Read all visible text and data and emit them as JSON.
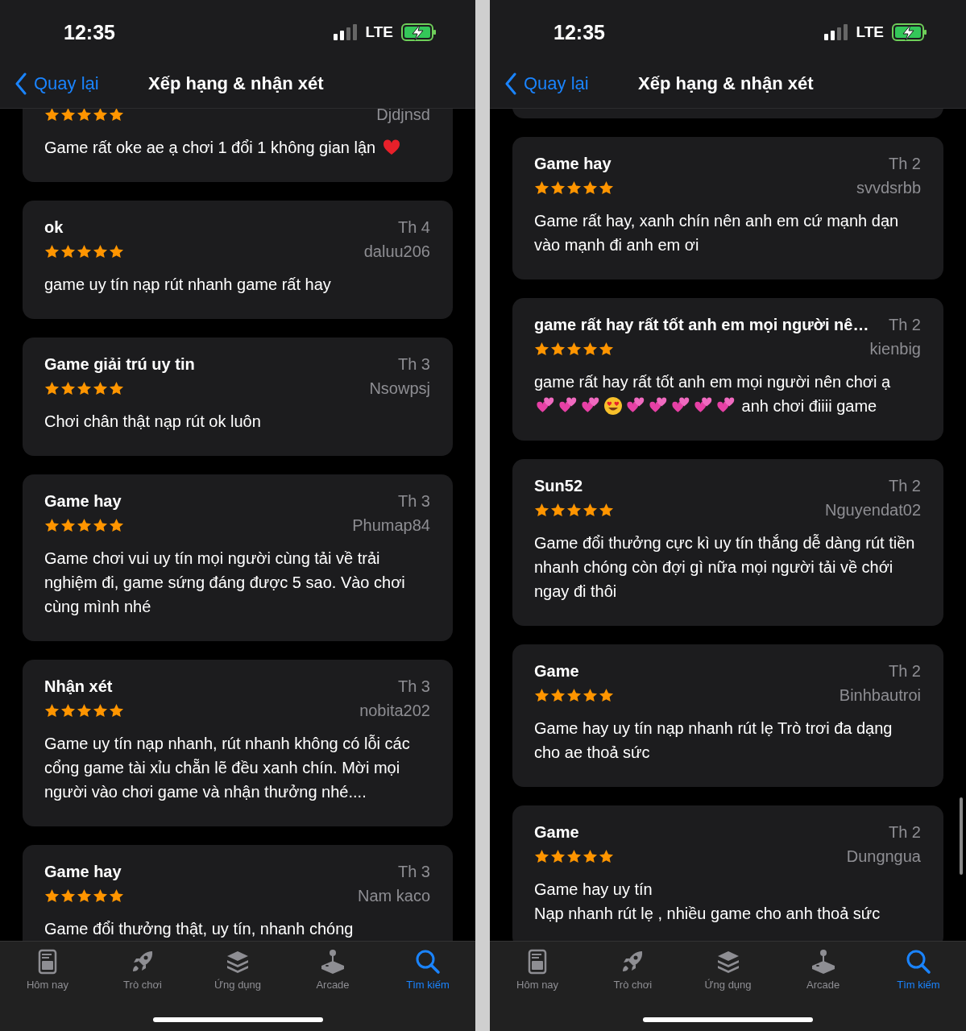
{
  "screens": [
    {
      "status_bar": {
        "time": "12:35",
        "network": "LTE"
      },
      "nav": {
        "back": "Quay lại",
        "title": "Xếp hạng & nhận xét"
      },
      "reviews": [
        {
          "stars": 5,
          "author": "Djdjnsd",
          "body": [
            {
              "kind": "text",
              "text": "Game rất oke ae ạ chơi 1 đổi 1 không gian lận "
            },
            {
              "kind": "heart"
            }
          ]
        },
        {
          "title": "ok",
          "date": "Th 4",
          "stars": 5,
          "author": "daluu206",
          "body": [
            {
              "kind": "text",
              "text": "game uy tín nạp rút nhanh game rất hay"
            }
          ]
        },
        {
          "title": "Game giải trú uy tin",
          "date": "Th 3",
          "stars": 5,
          "author": "Nsowpsj",
          "body": [
            {
              "kind": "text",
              "text": "Chơi chân thật nạp rút ok luôn"
            }
          ]
        },
        {
          "title": "Game hay",
          "date": "Th 3",
          "stars": 5,
          "author": "Phumap84",
          "body": [
            {
              "kind": "text",
              "text": "Game chơi vui uy tín mọi người cùng tải về trải nghiệm đi, game sứng đáng được 5 sao. Vào chơi cùng mình nhé"
            }
          ]
        },
        {
          "title": "Nhận xét",
          "date": "Th 3",
          "stars": 5,
          "author": "nobita202",
          "body": [
            {
              "kind": "text",
              "text": "Game uy tín nạp nhanh, rút nhanh không có lỗi các cổng game tài xỉu chẵn lẽ đều xanh chín. Mời mọi người vào chơi game và nhận thưởng nhé...."
            }
          ]
        },
        {
          "title": "Game hay",
          "date": "Th 3",
          "stars": 5,
          "author": "Nam kaco",
          "body": [
            {
              "kind": "text",
              "text": "Game đổi thưởng thật, uy tín, nhanh chóng"
            }
          ]
        }
      ],
      "tabs": [
        {
          "label": "Hôm nay",
          "selected": false
        },
        {
          "label": "Trò chơi",
          "selected": false
        },
        {
          "label": "Ứng dụng",
          "selected": false
        },
        {
          "label": "Arcade",
          "selected": false
        },
        {
          "label": "Tìm kiếm",
          "selected": true
        }
      ]
    },
    {
      "status_bar": {
        "time": "12:35",
        "network": "LTE"
      },
      "nav": {
        "back": "Quay lại",
        "title": "Xếp hạng & nhận xét"
      },
      "reviews": [
        {
          "title": "Game hay",
          "date": "Th 2",
          "stars": 5,
          "author": "svvdsrbb",
          "body": [
            {
              "kind": "text",
              "text": "Game rất hay, xanh chín nên anh em cứ mạnh dạn vào mạnh đi anh em ơi"
            }
          ]
        },
        {
          "title": "game rất hay rất tốt anh em mọi người nê…",
          "date": "Th 2",
          "stars": 5,
          "author": "kienbig",
          "body": [
            {
              "kind": "text",
              "text": "game rất hay rất tốt anh em mọi người nên chơi ạ "
            },
            {
              "kind": "two-hearts"
            },
            {
              "kind": "two-hearts"
            },
            {
              "kind": "two-hearts"
            },
            {
              "kind": "heart-eyes"
            },
            {
              "kind": "two-hearts"
            },
            {
              "kind": "two-hearts"
            },
            {
              "kind": "two-hearts"
            },
            {
              "kind": "two-hearts"
            },
            {
              "kind": "two-hearts"
            },
            {
              "kind": "text",
              "text": " anh chơi điiii game"
            }
          ]
        },
        {
          "title": "Sun52",
          "date": "Th 2",
          "stars": 5,
          "author": "Nguyendat02",
          "body": [
            {
              "kind": "text",
              "text": "Game đổi thưởng cực kì uy tín thắng dễ dàng rút tiền nhanh chóng còn đợi gì nữa mọi người tải về chới ngay đi thôi"
            }
          ]
        },
        {
          "title": "Game",
          "date": "Th 2",
          "stars": 5,
          "author": "Binhbautroi",
          "body": [
            {
              "kind": "text",
              "text": "Game hay uy tín nạp nhanh rút lẹ Trò trơi đa dạng cho ae thoả sức"
            }
          ]
        },
        {
          "title": "Game",
          "date": "Th 2",
          "stars": 5,
          "author": "Dungngua",
          "body": [
            {
              "kind": "text",
              "text": "Game hay uy tín\nNạp nhanh rút lẹ , nhiều game cho anh thoả sức"
            }
          ]
        }
      ],
      "tabs": [
        {
          "label": "Hôm nay",
          "selected": false
        },
        {
          "label": "Trò chơi",
          "selected": false
        },
        {
          "label": "Ứng dụng",
          "selected": false
        },
        {
          "label": "Arcade",
          "selected": false
        },
        {
          "label": "Tìm kiếm",
          "selected": true
        }
      ]
    }
  ]
}
